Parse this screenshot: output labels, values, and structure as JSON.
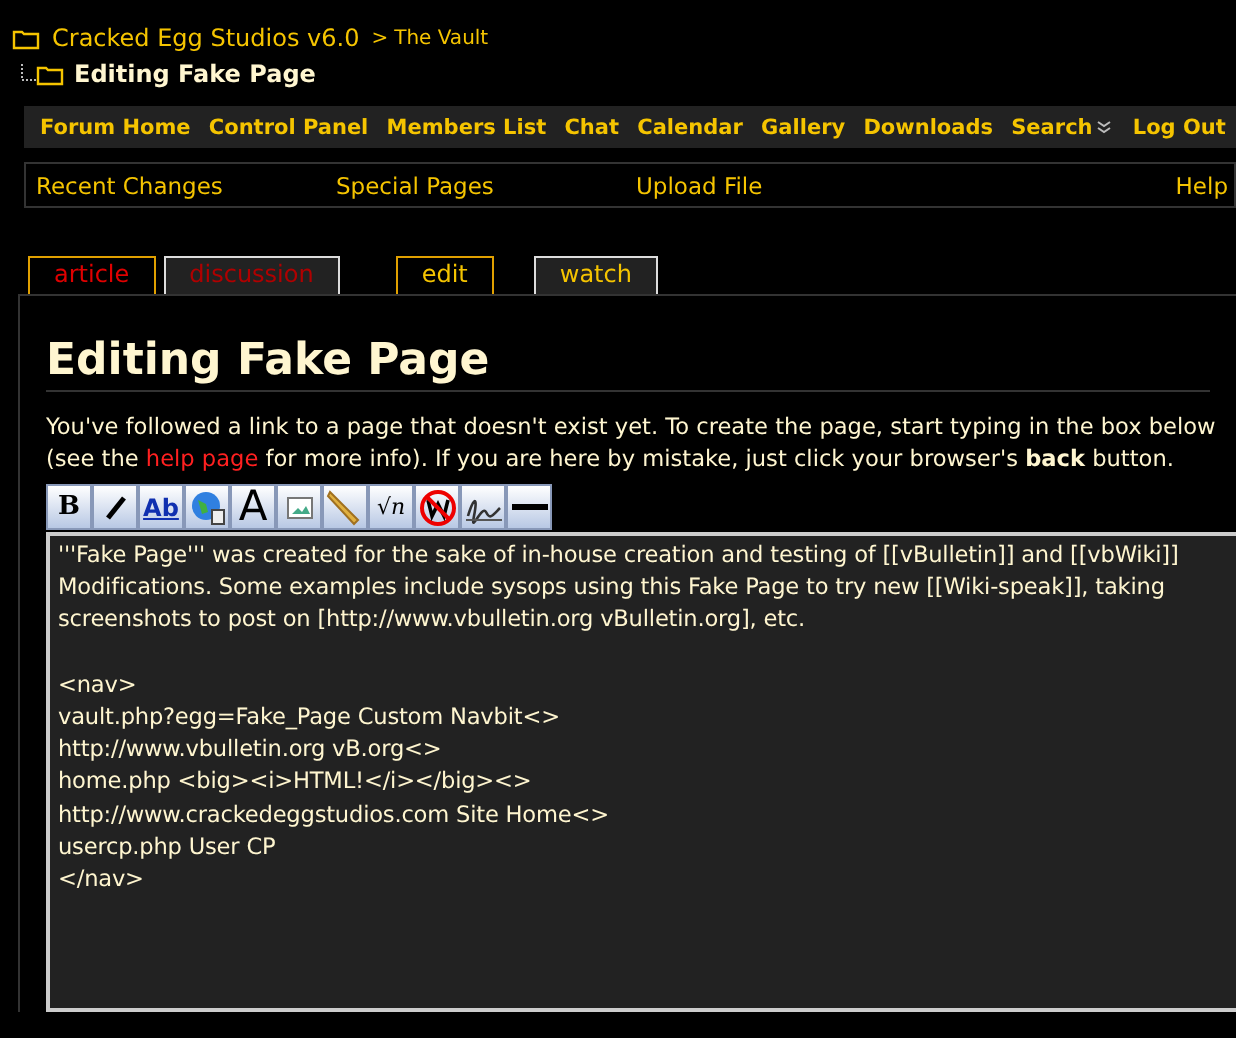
{
  "breadcrumb": {
    "site": "Cracked Egg Studios v6.0",
    "separator": ">",
    "section": "The Vault",
    "current": "Editing Fake Page"
  },
  "navbar": [
    {
      "label": "Forum Home",
      "kind": "link"
    },
    {
      "label": "Control Panel",
      "kind": "link"
    },
    {
      "label": "Members List",
      "kind": "link"
    },
    {
      "label": "Chat",
      "kind": "link"
    },
    {
      "label": "Calendar",
      "kind": "link"
    },
    {
      "label": "Gallery",
      "kind": "link"
    },
    {
      "label": "Downloads",
      "kind": "link"
    },
    {
      "label": "Search",
      "kind": "menu"
    },
    {
      "label": "Log Out",
      "kind": "link"
    }
  ],
  "wiki_links": [
    "Recent Changes",
    "Special Pages",
    "Upload File",
    "Help"
  ],
  "tabs": [
    {
      "label": "article",
      "selected": true,
      "missing": true
    },
    {
      "label": "discussion",
      "selected": false,
      "missing": true
    },
    {
      "label": "edit",
      "selected": true,
      "missing": false
    },
    {
      "label": "watch",
      "selected": false,
      "missing": false
    }
  ],
  "heading": "Editing Fake Page",
  "intro": {
    "before": "You've followed a link to a page that doesn't exist yet. To create the page, start typing in the box below (see the",
    "link": "help page",
    "after": "for more info). If you are here by mistake, just click your browser's **back** button."
  },
  "toolbar": [
    {
      "kind": "bold",
      "glyph": "B"
    },
    {
      "kind": "italic"
    },
    {
      "kind": "link",
      "glyph": "Ab"
    },
    {
      "kind": "external"
    },
    {
      "kind": "headline",
      "glyph": "A"
    },
    {
      "kind": "image"
    },
    {
      "kind": "media"
    },
    {
      "kind": "math",
      "glyph": "√n"
    },
    {
      "kind": "nowiki"
    },
    {
      "kind": "signature"
    },
    {
      "kind": "rule"
    }
  ],
  "editor": {
    "value": "'''Fake Page''' was created for the sake of in-house creation and testing of [[vBulletin]] and [[vbWiki]] Modifications. Some examples include sysops using this Fake Page to try new [[Wiki-speak]], taking screenshots to post on [http://www.vbulletin.org vBulletin.org], etc.\n\n<nav>\nvault.php?egg=Fake_Page Custom Navbit<>\nhttp://www.vbulletin.org vB.org<>\nhome.php <big><i>HTML!</i></big><>\nhttp://www.crackedeggstudios.com Site Home<>\nusercp.php User CP\n</nav>"
  }
}
